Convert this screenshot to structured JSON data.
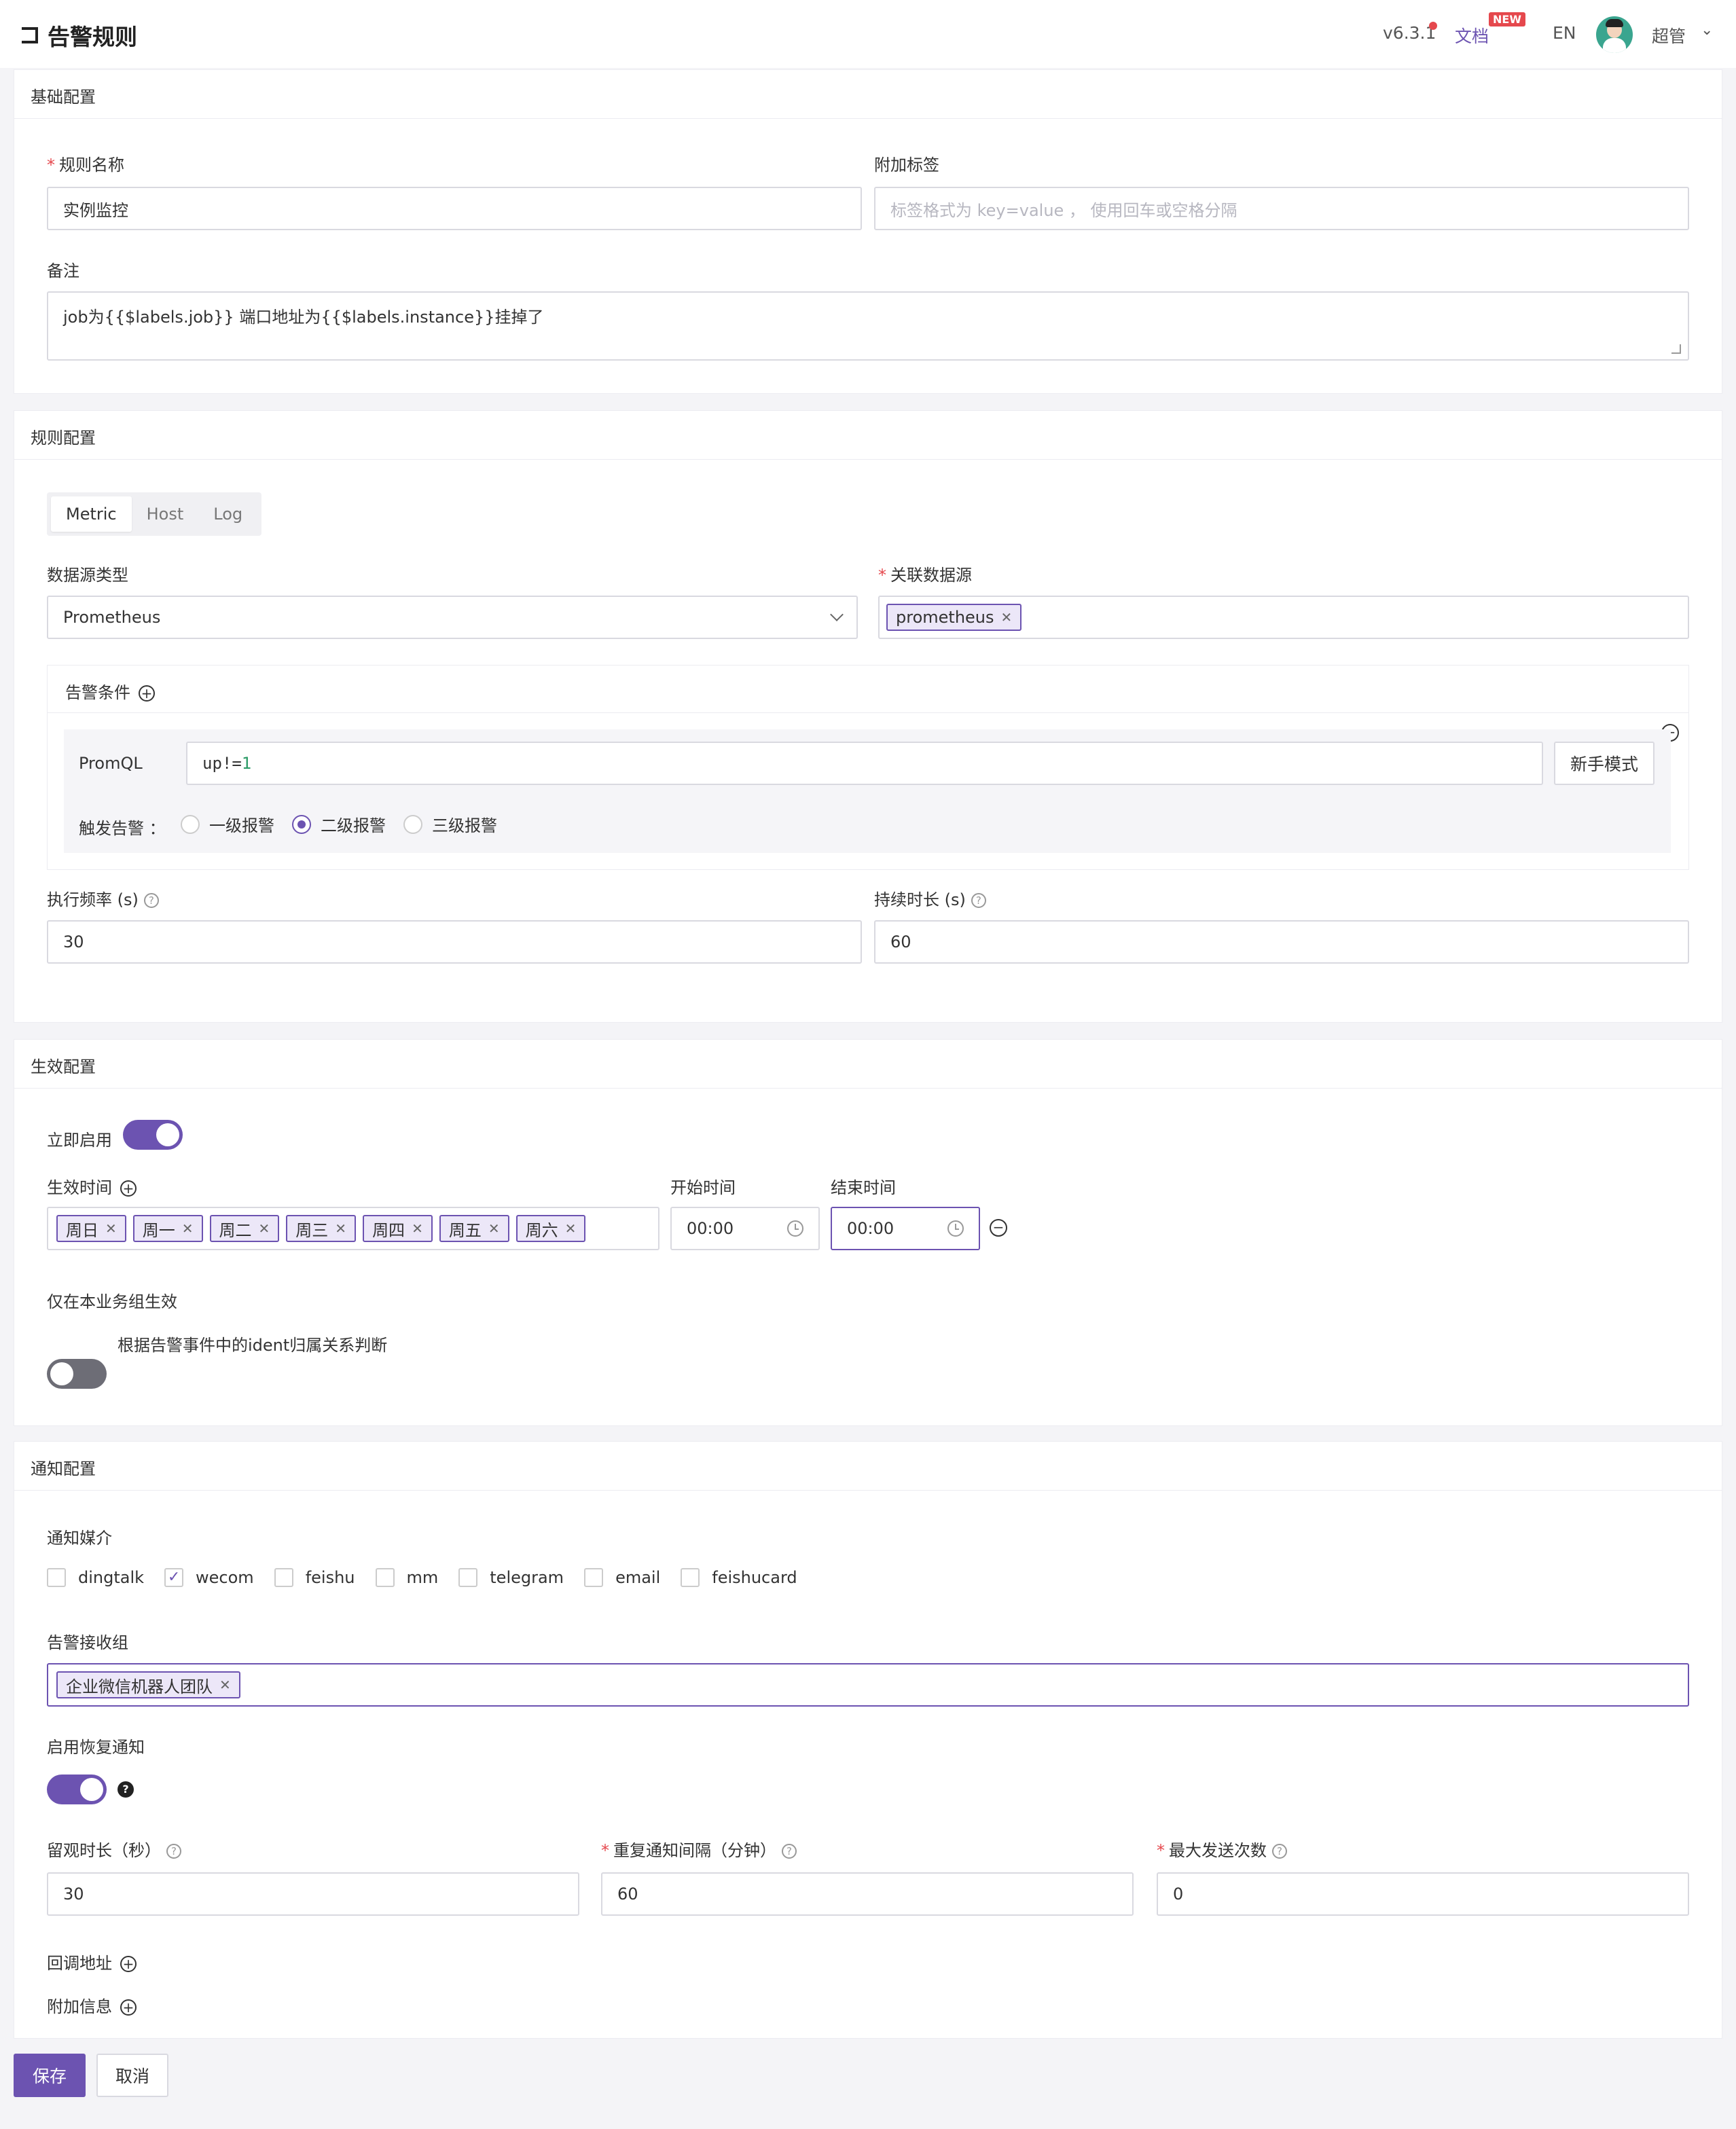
{
  "header": {
    "title": "告警规则",
    "version": "v6.3.1",
    "docs": "文档",
    "new_badge": "NEW",
    "lang": "EN",
    "user": "超管"
  },
  "basic": {
    "section_title": "基础配置",
    "rule_name_label": "规则名称",
    "rule_name_value": "实例监控",
    "tags_label": "附加标签",
    "tags_placeholder": "标签格式为 key=value ， 使用回车或空格分隔",
    "note_label": "备注",
    "note_value": "job为{{$labels.job}} 端口地址为{{$labels.instance}}挂掉了"
  },
  "rule": {
    "section_title": "规则配置",
    "tabs": [
      "Metric",
      "Host",
      "Log"
    ],
    "datasource_type_label": "数据源类型",
    "datasource_type_value": "Prometheus",
    "datasource_label": "关联数据源",
    "datasource_tag": "prometheus",
    "condition_title": "告警条件",
    "promql_label": "PromQL",
    "promql_prefix": "up!=",
    "promql_number": "1",
    "beginner_btn": "新手模式",
    "trigger_label": "触发告警 ：",
    "levels": [
      "一级报警",
      "二级报警",
      "三级报警"
    ],
    "selected_level": "二级报警",
    "frequency_label": "执行频率 (s)",
    "frequency_value": "30",
    "duration_label": "持续时长 (s)",
    "duration_value": "60"
  },
  "effective": {
    "section_title": "生效配置",
    "enable_label": "立即启用",
    "enable_on": true,
    "time_label": "生效时间",
    "days": [
      "周日",
      "周一",
      "周二",
      "周三",
      "周四",
      "周五",
      "周六"
    ],
    "start_label": "开始时间",
    "start_value": "00:00",
    "end_label": "结束时间",
    "end_value": "00:00",
    "bizgroup_label": "仅在本业务组生效",
    "bizgroup_on": false,
    "bizgroup_desc": "根据告警事件中的ident归属关系判断"
  },
  "notify": {
    "section_title": "通知配置",
    "media_label": "通知媒介",
    "channels": [
      {
        "name": "dingtalk",
        "checked": false
      },
      {
        "name": "wecom",
        "checked": true
      },
      {
        "name": "feishu",
        "checked": false
      },
      {
        "name": "mm",
        "checked": false
      },
      {
        "name": "telegram",
        "checked": false
      },
      {
        "name": "email",
        "checked": false
      },
      {
        "name": "feishucard",
        "checked": false
      }
    ],
    "groups_label": "告警接收组",
    "group_tag": "企业微信机器人团队",
    "recover_label": "启用恢复通知",
    "recover_on": true,
    "recover_help": "?",
    "observe_label": "留观时长（秒）",
    "observe_value": "30",
    "repeat_label": "重复通知间隔（分钟）",
    "repeat_value": "60",
    "max_label": "最大发送次数",
    "max_value": "0",
    "callback_label": "回调地址",
    "extra_label": "附加信息"
  },
  "actions": {
    "save": "保存",
    "cancel": "取消"
  },
  "colors": {
    "accent": "#6c53b1",
    "required": "#e5484d",
    "promql_number": "#2b9a66"
  },
  "icons": [
    "back-icon",
    "chevron-down-icon",
    "plus-circle-icon",
    "minus-circle-icon",
    "help-icon",
    "clock-icon",
    "close-icon",
    "check-icon",
    "resize-icon"
  ]
}
